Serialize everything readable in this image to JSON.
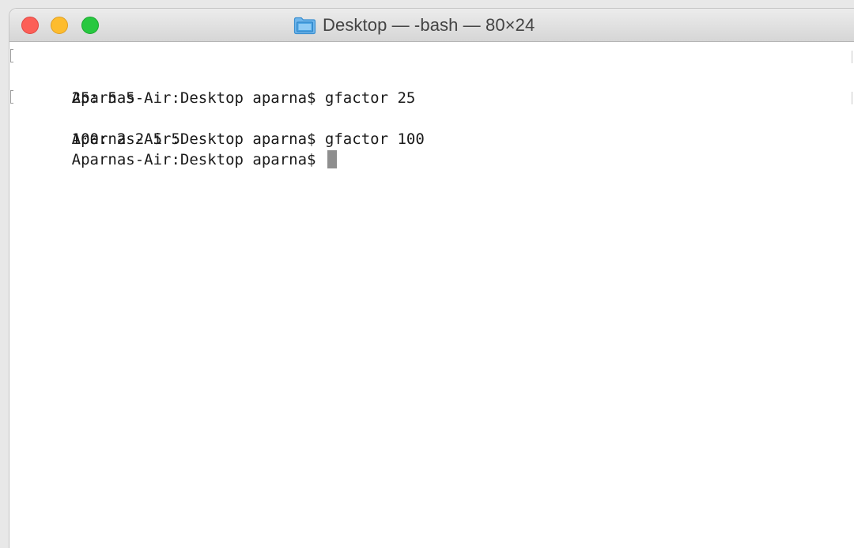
{
  "window": {
    "title": "Desktop — -bash — 80×24",
    "icon": "folder-icon",
    "colors": {
      "close": "#fc5f57",
      "minimize": "#fdbc2e",
      "zoom": "#28c840",
      "folder": "#4aa3e3"
    }
  },
  "terminal": {
    "lines": [
      {
        "text": "Aparnas-Air:Desktop aparna$ gfactor 25",
        "marked": true
      },
      {
        "text": "25: 5 5",
        "marked": false
      },
      {
        "text": "Aparnas-Air:Desktop aparna$ gfactor 100",
        "marked": true
      },
      {
        "text": "100: 2 2 5 5",
        "marked": false
      }
    ],
    "prompt": "Aparnas-Air:Desktop aparna$ "
  }
}
